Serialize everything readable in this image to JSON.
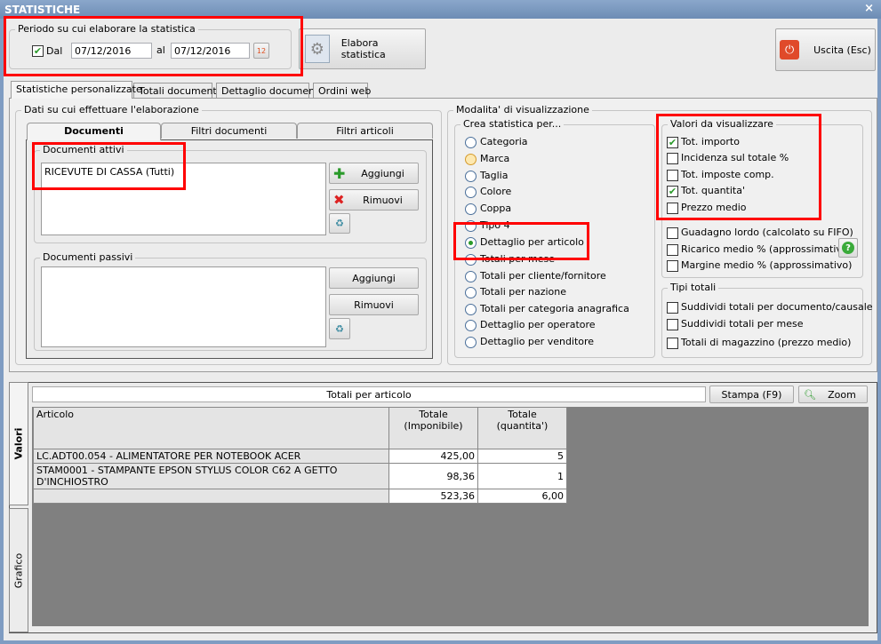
{
  "window": {
    "title": "STATISTICHE",
    "close": "×"
  },
  "period": {
    "legend": "Periodo su cui elaborare la statistica",
    "dal_label": "Dal",
    "dal_checked": true,
    "from": "07/12/2016",
    "al_label": "al",
    "to": "07/12/2016"
  },
  "toolbar": {
    "elabora": "Elabora statistica",
    "uscita": "Uscita (Esc)"
  },
  "tabs": [
    "Statistiche personalizzate",
    "Totali documenti",
    "Dettaglio documenti",
    "Ordini web"
  ],
  "dati": {
    "legend": "Dati su cui effettuare l'elaborazione",
    "tabs": [
      "Documenti",
      "Filtri documenti",
      "Filtri articoli"
    ],
    "attivi": {
      "legend": "Documenti attivi",
      "items": [
        "RICEVUTE DI CASSA (Tutti)"
      ],
      "add": "Aggiungi",
      "remove": "Rimuovi"
    },
    "passivi": {
      "legend": "Documenti passivi",
      "items": [],
      "add": "Aggiungi",
      "remove": "Rimuovi"
    }
  },
  "modalita": {
    "legend": "Modalita' di visualizzazione",
    "crea": {
      "legend": "Crea statistica per...",
      "options": [
        "Categoria",
        "Marca",
        "Taglia",
        "Colore",
        "Coppa",
        "Tipo 4",
        "Dettaglio per articolo",
        "Totali per mese",
        "Totali per cliente/fornitore",
        "Totali per nazione",
        "Totali per categoria anagrafica",
        "Dettaglio per operatore",
        "Dettaglio per venditore"
      ],
      "selected": "Dettaglio per articolo"
    },
    "valori": {
      "legend": "Valori da visualizzare",
      "options": [
        {
          "label": "Tot. importo",
          "checked": true
        },
        {
          "label": "Incidenza sul totale %",
          "checked": false
        },
        {
          "label": "Tot. imposte comp.",
          "checked": false
        },
        {
          "label": "Tot. quantita'",
          "checked": true
        },
        {
          "label": "Prezzo medio",
          "checked": false
        },
        {
          "label": "Guadagno lordo (calcolato su FIFO)",
          "checked": false
        },
        {
          "label": "Ricarico medio % (approssimativo)",
          "checked": false
        },
        {
          "label": "Margine medio % (approssimativo)",
          "checked": false
        }
      ]
    },
    "tipi": {
      "legend": "Tipi totali",
      "options": [
        {
          "label": "Suddividi totali per documento/causale",
          "checked": false
        },
        {
          "label": "Suddividi totali per mese",
          "checked": false
        },
        {
          "label": "Totali di magazzino (prezzo medio)",
          "checked": false
        }
      ]
    }
  },
  "results": {
    "side_tabs": [
      "Valori",
      "Grafico"
    ],
    "title": "Totali per articolo",
    "stampa": "Stampa (F9)",
    "zoom": "Zoom",
    "columns": [
      "Articolo",
      "Totale\n(Imponibile)",
      "Totale\n(quantita')"
    ],
    "rows": [
      [
        "LC.ADT00.054 - ALIMENTATORE PER NOTEBOOK ACER",
        "425,00",
        "5"
      ],
      [
        "STAM0001 - STAMPANTE EPSON STYLUS COLOR C62 A GETTO D'INCHIOSTRO",
        "98,36",
        "1"
      ],
      [
        "",
        "523,36",
        "6,00"
      ]
    ]
  }
}
